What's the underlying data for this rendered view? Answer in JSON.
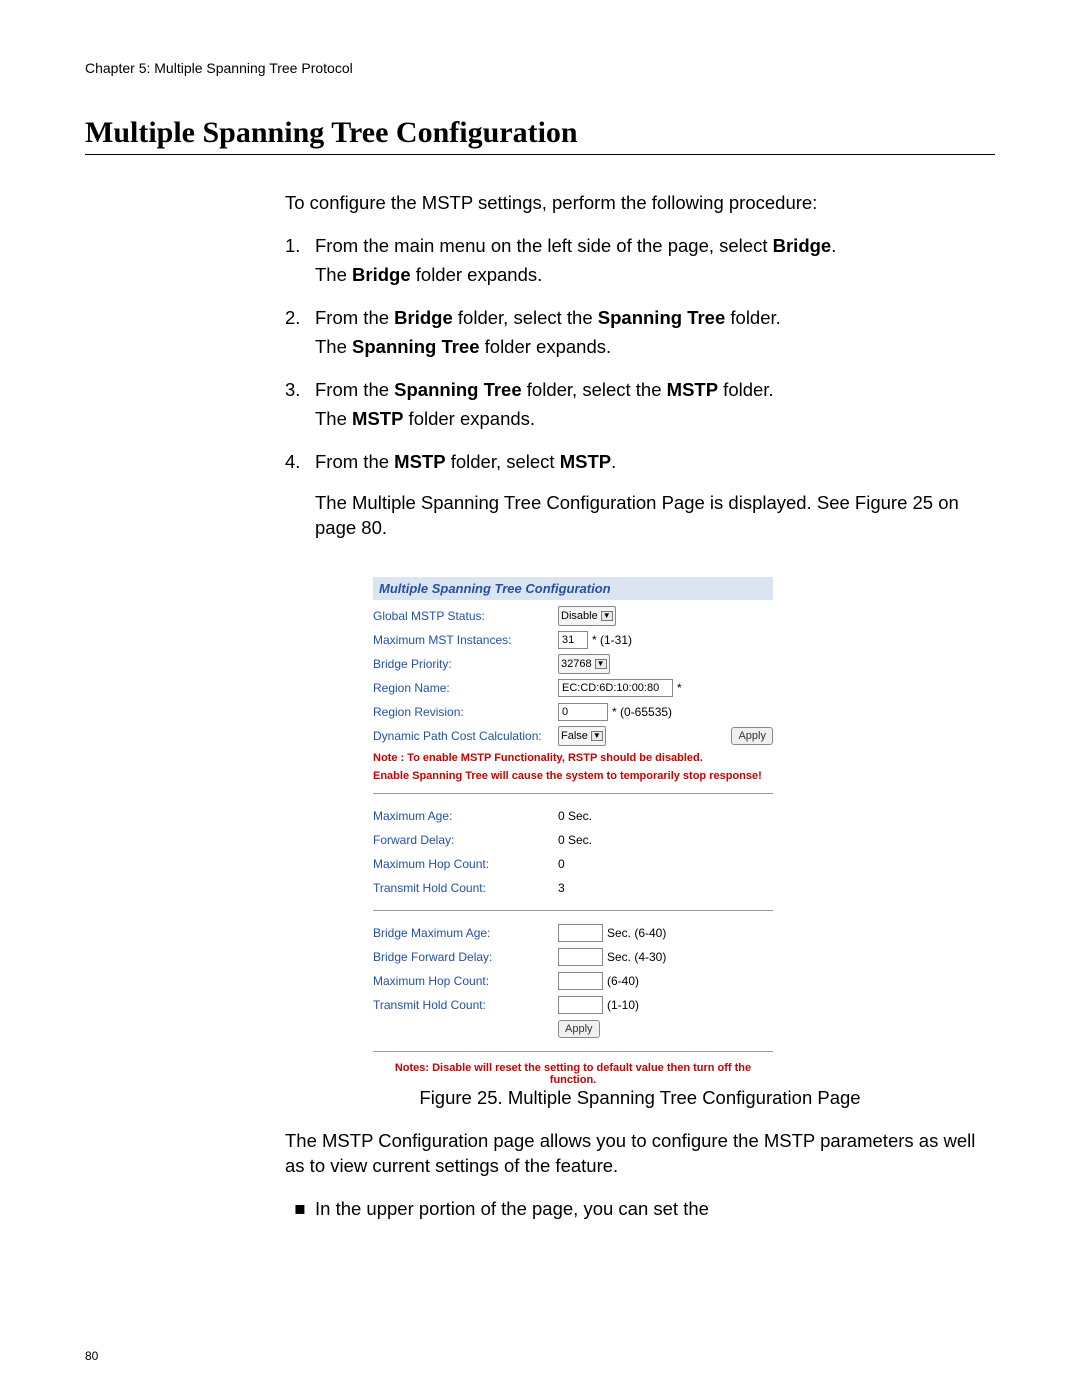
{
  "chapter": "Chapter 5: Multiple Spanning Tree Protocol",
  "heading": "Multiple Spanning Tree Configuration",
  "page_number": "80",
  "intro": "To configure the MSTP settings, perform the following procedure:",
  "steps": {
    "n1": "1.",
    "s1a": "From the main menu on the left side of the page, select ",
    "s1b": "Bridge",
    "s1c": ".",
    "s1d": "The ",
    "s1e": "Bridge",
    "s1f": " folder expands.",
    "n2": "2.",
    "s2a": "From the ",
    "s2b": "Bridge",
    "s2c": " folder, select the ",
    "s2d": "Spanning Tree",
    "s2e": " folder.",
    "s2f": "The ",
    "s2g": "Spanning Tree",
    "s2h": " folder expands.",
    "n3": "3.",
    "s3a": "From the ",
    "s3b": "Spanning Tree",
    "s3c": " folder, select the ",
    "s3d": "MSTP",
    "s3e": " folder.",
    "s3f": "The ",
    "s3g": "MSTP",
    "s3h": " folder expands.",
    "n4": "4.",
    "s4a": "From the ",
    "s4b": "MSTP",
    "s4c": " folder, select ",
    "s4d": "MSTP",
    "s4e": ".",
    "post1": "The Multiple Spanning Tree Configuration Page is displayed. See Figure 25 on page 80."
  },
  "panel": {
    "title": "Multiple Spanning Tree Configuration",
    "r1_label": "Global MSTP Status:",
    "r1_value": "Disable",
    "r2_label": "Maximum MST Instances:",
    "r2_value": "31",
    "r2_hint": "* (1-31)",
    "r3_label": "Bridge Priority:",
    "r3_value": "32768",
    "r4_label": "Region Name:",
    "r4_value": "EC:CD:6D:10:00:80",
    "r4_hint": "*",
    "r5_label": "Region Revision:",
    "r5_value": "0",
    "r5_hint": "* (0-65535)",
    "r6_label": "Dynamic Path Cost Calculation:",
    "r6_value": "False",
    "apply": "Apply",
    "note1": "Note : To enable MSTP Functionality, RSTP should be disabled.",
    "note2": "Enable Spanning Tree will cause the system to temporarily stop response!",
    "s1_label": "Maximum Age:",
    "s1_value": "0 Sec.",
    "s2_label": "Forward Delay:",
    "s2_value": "0 Sec.",
    "s3_label": "Maximum Hop Count:",
    "s3_value": "0",
    "s4_label": "Transmit Hold Count:",
    "s4_value": "3",
    "b1_label": "Bridge Maximum Age:",
    "b1_hint": "Sec. (6-40)",
    "b2_label": "Bridge Forward Delay:",
    "b2_hint": "Sec. (4-30)",
    "b3_label": "Maximum Hop Count:",
    "b3_hint": "(6-40)",
    "b4_label": "Transmit Hold Count:",
    "b4_hint": "(1-10)",
    "note3": "Notes: Disable will reset the setting to default value then turn off the function."
  },
  "caption": "Figure 25. Multiple Spanning Tree Configuration Page",
  "after1": "The MSTP Configuration page allows you to configure the MSTP parameters as well as to view current settings of the feature.",
  "bullet_sym": "■",
  "bullet1": "In the upper portion of the page, you can set the"
}
